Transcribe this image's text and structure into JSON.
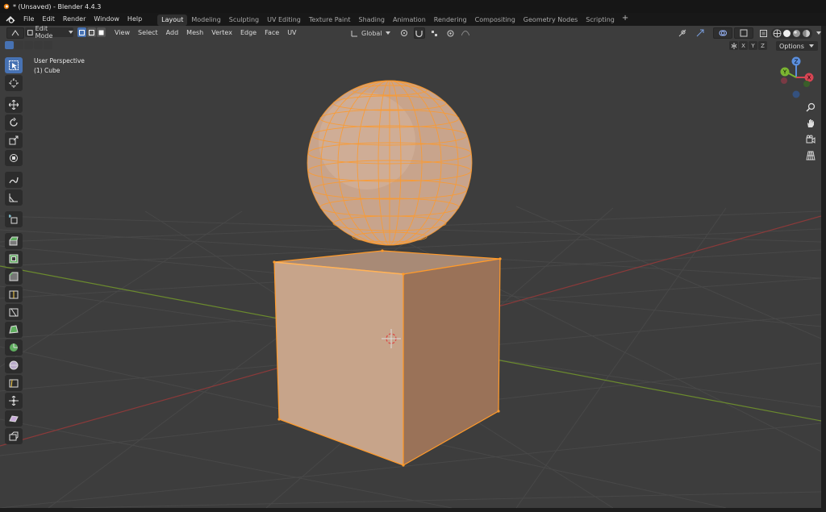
{
  "titlebar": {
    "title": "* (Unsaved) - Blender 4.4.3"
  },
  "menu": {
    "items": [
      "File",
      "Edit",
      "Render",
      "Window",
      "Help"
    ]
  },
  "workspaces": {
    "tabs": [
      "Layout",
      "Modeling",
      "Sculpting",
      "UV Editing",
      "Texture Paint",
      "Shading",
      "Animation",
      "Rendering",
      "Compositing",
      "Geometry Nodes",
      "Scripting"
    ],
    "active": "Layout",
    "add": "+"
  },
  "header": {
    "mode": "Edit Mode",
    "menus": [
      "View",
      "Select",
      "Add",
      "Mesh",
      "Vertex",
      "Edge",
      "Face",
      "UV"
    ],
    "transform_orientation": "Global",
    "options": "Options"
  },
  "axis_toggles": [
    "X",
    "Y",
    "Z"
  ],
  "viewport": {
    "view_name": "User Perspective",
    "object_name": "(1) Cube"
  },
  "gizmo": {
    "z": "Z",
    "y": "Y",
    "x": "X"
  },
  "colors": {
    "viewport_bg": "#3d3d3d",
    "selection": "#ff9a2a",
    "face_fill": "#c7a48a",
    "active_tool": "#4772b3"
  }
}
